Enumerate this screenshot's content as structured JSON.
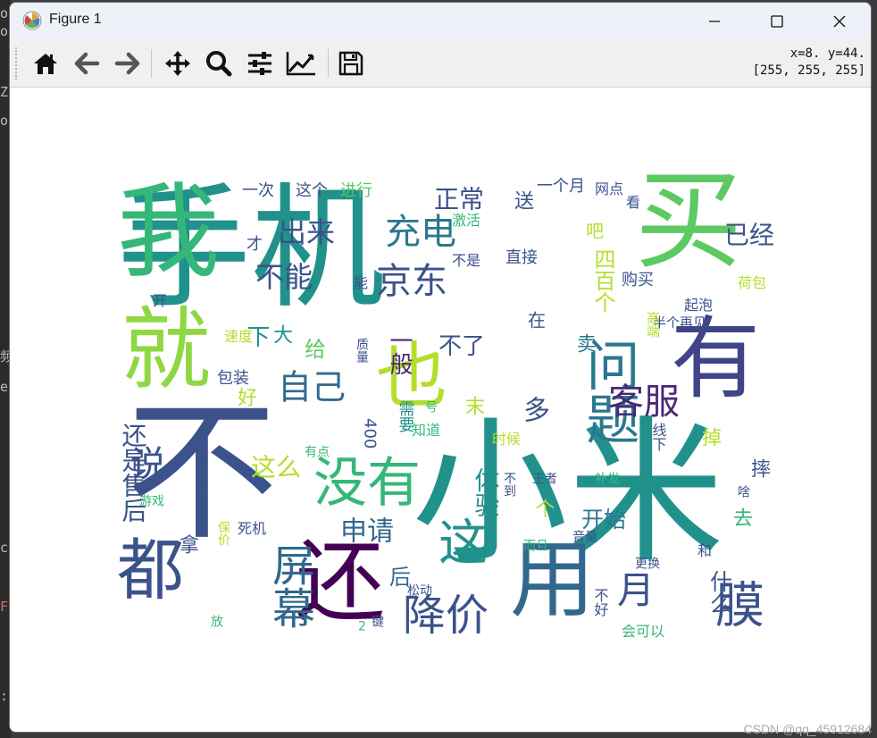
{
  "window": {
    "title": "Figure 1",
    "controls": [
      "minimize",
      "maximize",
      "close"
    ]
  },
  "toolbar": {
    "buttons": [
      {
        "name": "home",
        "icon": "home-icon"
      },
      {
        "name": "back",
        "icon": "arrow-left-icon"
      },
      {
        "name": "forward",
        "icon": "arrow-right-icon"
      },
      {
        "name": "pan",
        "icon": "move-icon"
      },
      {
        "name": "zoom",
        "icon": "magnifier-icon"
      },
      {
        "name": "configure-subplots",
        "icon": "sliders-icon"
      },
      {
        "name": "edit-axis",
        "icon": "line-chart-icon"
      },
      {
        "name": "save",
        "icon": "floppy-icon"
      }
    ],
    "coord_line1": "x=8. y=44.",
    "coord_line2": "[255, 255, 255]"
  },
  "background_fragments": [
    "ou",
    "Ec",
    "Z",
    "or",
    "频",
    "er",
    "ct",
    "Fe",
    ":"
  ],
  "watermark": "CSDN @qq_45912684",
  "colors": {
    "titlebar": "#eef1f8",
    "toolbar": "#f0f0f0",
    "canvas": "#ffffff",
    "palette": [
      "#440154",
      "#3b528b",
      "#21918c",
      "#5ec962",
      "#b5de2b",
      "#31688e",
      "#2a788e",
      "#35b779",
      "#482878",
      "#90d743"
    ]
  },
  "wordcloud": {
    "words": [
      {
        "text": "手机",
        "color": "#21918c"
      },
      {
        "text": "不",
        "color": "#3b528b"
      },
      {
        "text": "买",
        "color": "#5ec962"
      },
      {
        "text": "我",
        "color": "#35b779"
      },
      {
        "text": "小米",
        "color": "#21918c"
      },
      {
        "text": "就",
        "color": "#90d743"
      },
      {
        "text": "有",
        "color": "#414487"
      },
      {
        "text": "都",
        "color": "#3b528b"
      },
      {
        "text": "还",
        "color": "#440154"
      },
      {
        "text": "用",
        "color": "#31688e"
      },
      {
        "text": "也",
        "color": "#b5de2b"
      },
      {
        "text": "问题",
        "color": "#2a788e"
      },
      {
        "text": "没有",
        "color": "#35b779"
      },
      {
        "text": "这",
        "color": "#21918c"
      },
      {
        "text": "降价",
        "color": "#3b528b"
      },
      {
        "text": "膜",
        "color": "#3b528b"
      },
      {
        "text": "屏幕",
        "color": "#31688e"
      },
      {
        "text": "说",
        "color": "#3b528b"
      },
      {
        "text": "客服",
        "color": "#482878"
      },
      {
        "text": "自己",
        "color": "#31688e"
      },
      {
        "text": "京东",
        "color": "#3b528b"
      },
      {
        "text": "充电",
        "color": "#2a788e"
      },
      {
        "text": "月",
        "color": "#3b528b"
      },
      {
        "text": "不能",
        "color": "#3b528b"
      },
      {
        "text": "出来",
        "color": "#3b528b"
      },
      {
        "text": "正常",
        "color": "#3b528b"
      },
      {
        "text": "已经",
        "color": "#3b528b"
      },
      {
        "text": "申请",
        "color": "#31688e"
      },
      {
        "text": "这么",
        "color": "#b5de2b"
      },
      {
        "text": "体验",
        "color": "#21918c"
      },
      {
        "text": "一般",
        "color": "#482878"
      },
      {
        "text": "不了",
        "color": "#3b528b"
      },
      {
        "text": "多",
        "color": "#3b528b"
      },
      {
        "text": "还是售后",
        "color": "#3b528b"
      },
      {
        "text": "什么",
        "color": "#3b528b"
      },
      {
        "text": "开始",
        "color": "#2a788e"
      },
      {
        "text": "给",
        "color": "#5ec962"
      },
      {
        "text": "下",
        "color": "#21918c"
      },
      {
        "text": "大",
        "color": "#21918c"
      },
      {
        "text": "个",
        "color": "#b5de2b"
      },
      {
        "text": "四百个",
        "color": "#b5de2b"
      },
      {
        "text": "卖",
        "color": "#2a788e"
      },
      {
        "text": "掉",
        "color": "#b5de2b"
      },
      {
        "text": "摔",
        "color": "#3b528b"
      },
      {
        "text": "去",
        "color": "#35b779"
      },
      {
        "text": "后",
        "color": "#31688e"
      },
      {
        "text": "拿",
        "color": "#3b528b"
      },
      {
        "text": "末",
        "color": "#b5de2b"
      },
      {
        "text": "需要",
        "color": "#21918c"
      },
      {
        "text": "400",
        "color": "#3b528b"
      },
      {
        "text": "好",
        "color": "#b5de2b"
      },
      {
        "text": "才",
        "color": "#3b528b"
      },
      {
        "text": "在",
        "color": "#3b528b"
      },
      {
        "text": "送",
        "color": "#3b528b"
      },
      {
        "text": "吧",
        "color": "#b5de2b"
      },
      {
        "text": "一次",
        "color": "#3b528b"
      },
      {
        "text": "这个",
        "color": "#3b528b"
      },
      {
        "text": "进行",
        "color": "#5ec962"
      },
      {
        "text": "一个月",
        "color": "#3b528b"
      },
      {
        "text": "网点",
        "color": "#3b528b"
      },
      {
        "text": "看",
        "color": "#3b528b"
      },
      {
        "text": "激活",
        "color": "#35b779"
      },
      {
        "text": "不是",
        "color": "#3b528b"
      },
      {
        "text": "直接",
        "color": "#3b528b"
      },
      {
        "text": "购买",
        "color": "#3b528b"
      },
      {
        "text": "荷包",
        "color": "#b5de2b"
      },
      {
        "text": "能",
        "color": "#3b528b"
      },
      {
        "text": "起泡",
        "color": "#3b528b"
      },
      {
        "text": "开",
        "color": "#3b528b"
      },
      {
        "text": "半个",
        "color": "#3b528b"
      },
      {
        "text": "再见",
        "color": "#3b528b"
      },
      {
        "text": "速度",
        "color": "#b5de2b"
      },
      {
        "text": "质量",
        "color": "#3b528b"
      },
      {
        "text": "高端",
        "color": "#b5de2b"
      },
      {
        "text": "包装",
        "color": "#3b528b"
      },
      {
        "text": "号",
        "color": "#35b779"
      },
      {
        "text": "知道",
        "color": "#35b779"
      },
      {
        "text": "时候",
        "color": "#b5de2b"
      },
      {
        "text": "线下",
        "color": "#3b528b"
      },
      {
        "text": "有点",
        "color": "#35b779"
      },
      {
        "text": "补发",
        "color": "#35b779"
      },
      {
        "text": "王者",
        "color": "#3b528b"
      },
      {
        "text": "游戏",
        "color": "#35b779"
      },
      {
        "text": "不到",
        "color": "#3b528b"
      },
      {
        "text": "啥",
        "color": "#3b528b"
      },
      {
        "text": "死机",
        "color": "#3b528b"
      },
      {
        "text": "保价",
        "color": "#b5de2b"
      },
      {
        "text": "而且",
        "color": "#35b779"
      },
      {
        "text": "音量",
        "color": "#3b528b"
      },
      {
        "text": "和",
        "color": "#3b528b"
      },
      {
        "text": "更换",
        "color": "#3b528b"
      },
      {
        "text": "不好",
        "color": "#3b528b"
      },
      {
        "text": "松动",
        "color": "#3b528b"
      },
      {
        "text": "会可以",
        "color": "#35b779"
      },
      {
        "text": "2",
        "color": "#35b779"
      },
      {
        "text": "键",
        "color": "#3b528b"
      },
      {
        "text": "放",
        "color": "#35b779"
      }
    ]
  }
}
